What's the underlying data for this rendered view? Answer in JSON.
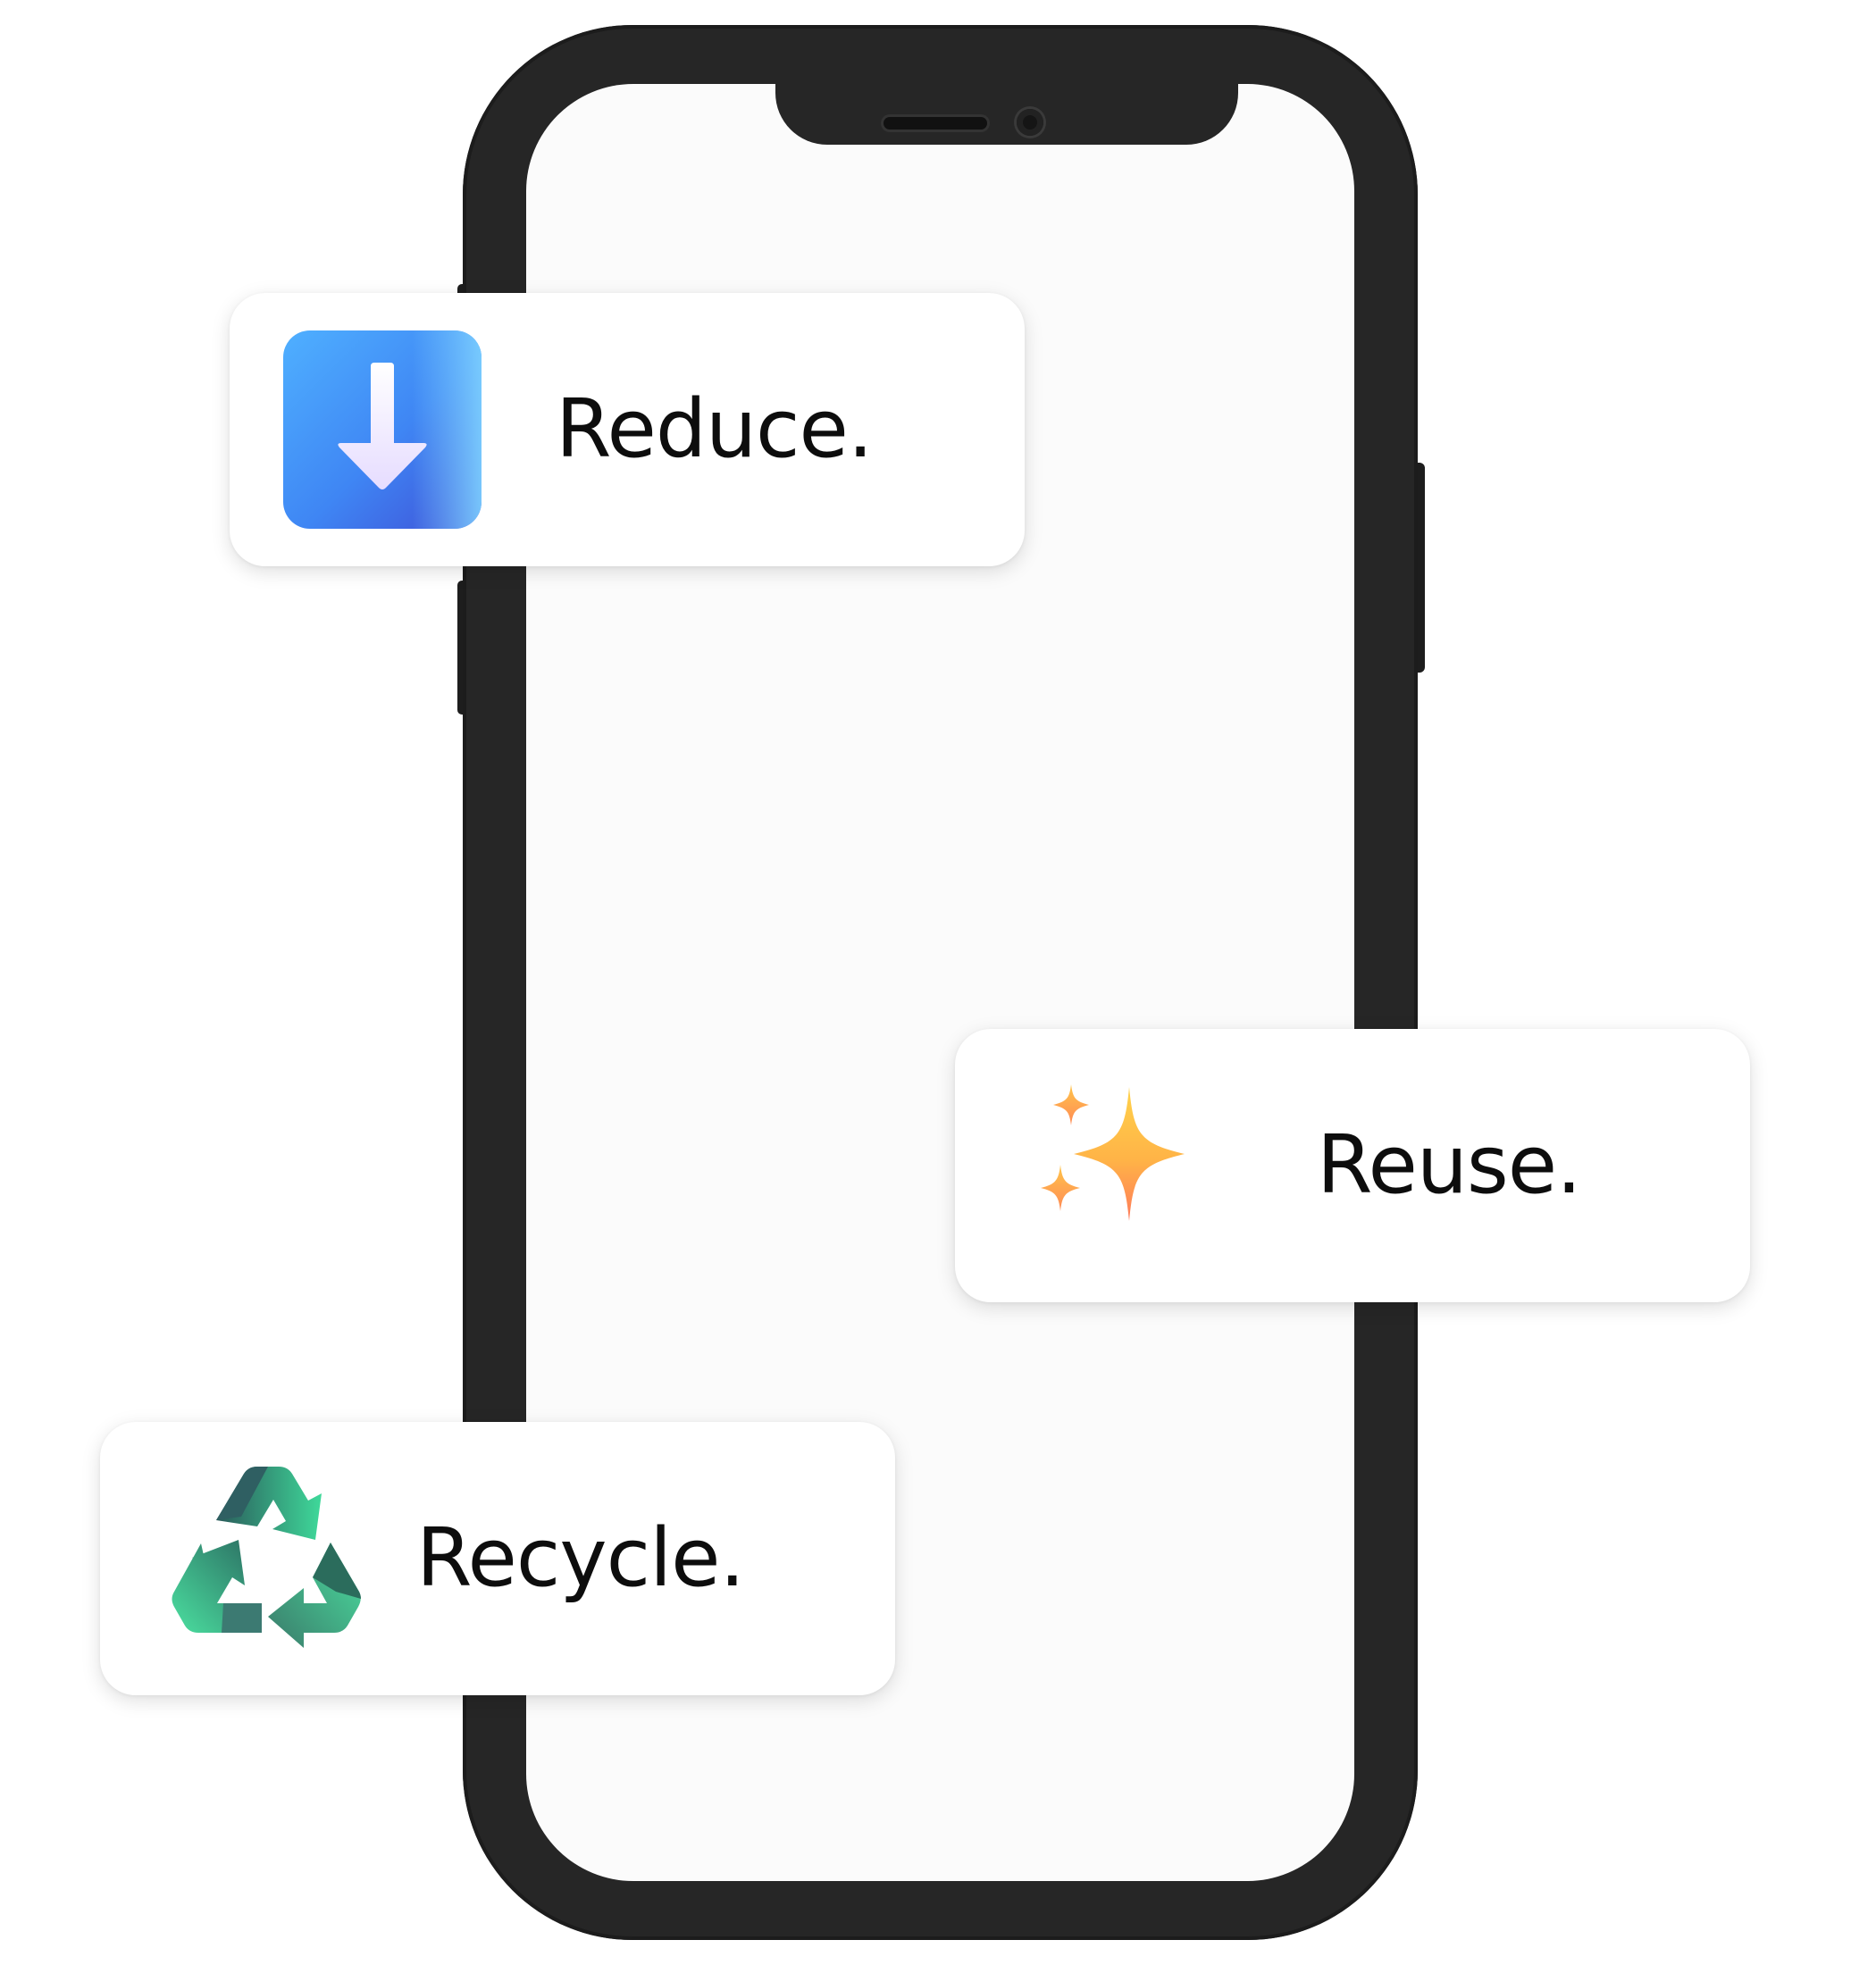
{
  "cards": {
    "reduce": {
      "label": "Reduce.",
      "icon": "down-arrow-icon"
    },
    "reuse": {
      "label": "Reuse.",
      "icon": "sparkles-icon"
    },
    "recycle": {
      "label": "Recycle.",
      "icon": "recycle-icon"
    }
  },
  "colors": {
    "phone_frame": "#262626",
    "phone_screen": "#fbfbfb",
    "reduce_blue": "#4a8ff7",
    "reuse_orange": "#ffb347",
    "recycle_green": "#3fd99a"
  }
}
